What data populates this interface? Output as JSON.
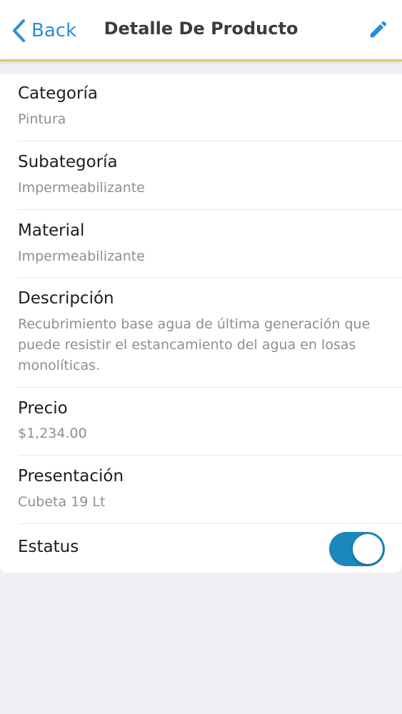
{
  "navbar": {
    "back_label": "Back",
    "title": "Detalle De Producto",
    "edit_icon": "pencil-icon",
    "accent_color": "#2c8ed6",
    "underline_color": "#e3c36f"
  },
  "fields": {
    "categoria": {
      "label": "Categoría",
      "value": "Pintura"
    },
    "subcategoria": {
      "label": "Subategoría",
      "value": "Impermeabilizante"
    },
    "material": {
      "label": "Material",
      "value": "Impermeabilizante"
    },
    "descripcion": {
      "label": "Descripción",
      "value": "Recubrimiento base agua de última generación que puede resistir el estancamiento del agua en losas monolíticas."
    },
    "precio": {
      "label": "Precio",
      "value": "$1,234.00"
    },
    "presentacion": {
      "label": "Presentación",
      "value": "Cubeta 19 Lt"
    },
    "estatus": {
      "label": "Estatus",
      "toggle_on": true,
      "toggle_color": "#1a87bd"
    }
  }
}
